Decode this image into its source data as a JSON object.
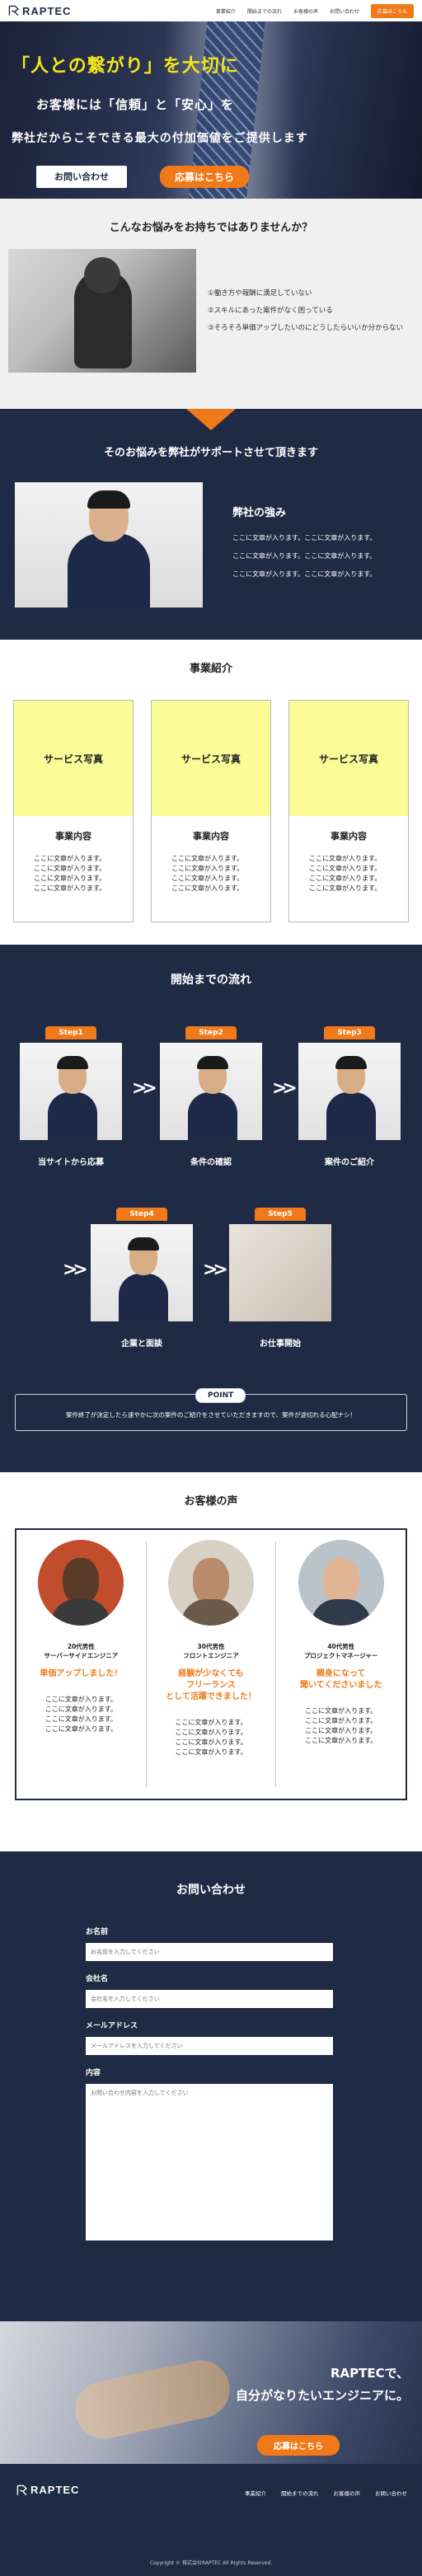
{
  "header": {
    "logo_text": "RAPTEC",
    "nav": [
      "事業紹介",
      "開始までの流れ",
      "お客様の声",
      "お問い合わせ"
    ],
    "apply_label": "応募はこちら"
  },
  "hero": {
    "title": "「人との繋がり」を大切に",
    "line2": "お客様には「信頼」と「安心」を",
    "line3": "弊社だからこそできる最大の付加価値をご提供します",
    "contact_button": "お問い合わせ",
    "apply_button": "応募はこちら"
  },
  "worries": {
    "title": "こんなお悩みをお持ちではありませんか？",
    "items": [
      "①働き方や報酬に満足していない",
      "②スキルにあった案件がなく困っている",
      "③そろそろ単価アップしたいのにどうしたらいいか分からない"
    ]
  },
  "support": {
    "title": "そのお悩みを弊社がサポートさせて頂きます",
    "heading": "弊社の強み",
    "lines": [
      "ここに文章が入ります。ここに文章が入ります。",
      "ここに文章が入ります。ここに文章が入ります。",
      "ここに文章が入ります。ここに文章が入ります。"
    ]
  },
  "business": {
    "title": "事業紹介",
    "cards": [
      {
        "photo": "サービス写真",
        "heading": "事業内容",
        "lines": [
          "ここに文章が入ります。",
          "ここに文章が入ります。",
          "ここに文章が入ります。",
          "ここに文章が入ります。"
        ]
      },
      {
        "photo": "サービス写真",
        "heading": "事業内容",
        "lines": [
          "ここに文章が入ります。",
          "ここに文章が入ります。",
          "ここに文章が入ります。",
          "ここに文章が入ります。"
        ]
      },
      {
        "photo": "サービス写真",
        "heading": "事業内容",
        "lines": [
          "ここに文章が入ります。",
          "ここに文章が入ります。",
          "ここに文章が入ります。",
          "ここに文章が入ります。"
        ]
      }
    ]
  },
  "flow": {
    "title": "開始までの流れ",
    "steps": [
      {
        "badge": "Step1",
        "label": "当サイトから応募"
      },
      {
        "badge": "Step2",
        "label": "条件の確認"
      },
      {
        "badge": "Step3",
        "label": "案件のご紹介"
      },
      {
        "badge": "Step4",
        "label": "企業と面談"
      },
      {
        "badge": "Step5",
        "label": "お仕事開始"
      }
    ],
    "point_badge": "POINT",
    "point_text": "案件終了が決定したら速やかに次の案件のご紹介をさせていただきますので、案件が途切れる心配ナシ！"
  },
  "voice": {
    "title": "お客様の声",
    "items": [
      {
        "role1": "20代男性",
        "role2": "サーバーサイドエンジニア",
        "headline": [
          "単価アップしました！"
        ],
        "lines": [
          "ここに文章が入ります。",
          "ここに文章が入ります。",
          "ここに文章が入ります。",
          "ここに文章が入ります。"
        ]
      },
      {
        "role1": "30代男性",
        "role2": "フロントエンジニア",
        "headline": [
          "経験が少なくても",
          "フリーランス",
          "として活躍できました！"
        ],
        "lines": [
          "ここに文章が入ります。",
          "ここに文章が入ります。",
          "ここに文章が入ります。",
          "ここに文章が入ります。"
        ]
      },
      {
        "role1": "40代男性",
        "role2": "プロジェクトマネージャー",
        "headline": [
          "親身になって",
          "聞いてくださいました"
        ],
        "lines": [
          "ここに文章が入ります。",
          "ここに文章が入ります。",
          "ここに文章が入ります。",
          "ここに文章が入ります。"
        ]
      }
    ]
  },
  "contact": {
    "title": "お問い合わせ",
    "name_label": "お名前",
    "name_placeholder": "お名前を入力してください",
    "company_label": "会社名",
    "company_placeholder": "会社名を入力してください",
    "email_label": "メールアドレス",
    "email_placeholder": "メールアドレスを入力してください",
    "message_label": "内容",
    "message_placeholder": "お問い合わせ内容を入力してください"
  },
  "cta": {
    "line1": "RAPTECで、",
    "line2": "自分がなりたいエンジニアに。",
    "button": "応募はこちら"
  },
  "footer": {
    "logo_text": "RAPTEC",
    "nav": [
      "事業紹介",
      "開始までの流れ",
      "お客様の声",
      "お問い合わせ"
    ],
    "copyright": "Copyright © 株式会社RAPTEC All Rights Reserved."
  },
  "colors": {
    "navy": "#1f2a44",
    "orange": "#f07a1a",
    "yellow": "#f4e41a",
    "card_yellow": "#fafc97"
  }
}
